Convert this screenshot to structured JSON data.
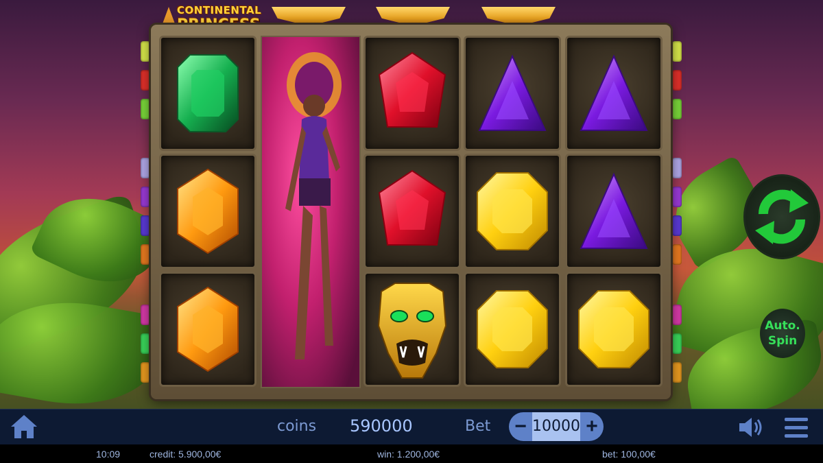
{
  "game": {
    "title_line1": "CONTINENTAL",
    "title_line2": "PRINCESS"
  },
  "reels": [
    [
      "emerald-green",
      "topaz-orange",
      "topaz-orange"
    ],
    [
      "princess-wild",
      "princess-wild",
      "princess-wild"
    ],
    [
      "ruby-red",
      "ruby-red",
      "jaguar-mask"
    ],
    [
      "amethyst-triangle",
      "citrine-yellow",
      "citrine-yellow"
    ],
    [
      "amethyst-triangle",
      "amethyst-triangle",
      "citrine-yellow"
    ]
  ],
  "controls": {
    "spin_icon": "refresh-arrows-icon",
    "auto_spin_line1": "Auto.",
    "auto_spin_line2": "Spin"
  },
  "bottom_bar": {
    "coins_label": "coins",
    "coins_value": "590000",
    "bet_label": "Bet",
    "bet_minus": "−",
    "bet_value": "10000",
    "bet_plus": "+"
  },
  "status_bar": {
    "time": "10:09",
    "credit": "credit: 5.900,00€",
    "win": "win: 1.200,00€",
    "bet": "bet: 100,00€"
  },
  "colors": {
    "bar_bg": "#0d1a33",
    "accent_blue": "#5e81c8",
    "spin_green": "#22c93a",
    "gold": "#ffd23a"
  }
}
